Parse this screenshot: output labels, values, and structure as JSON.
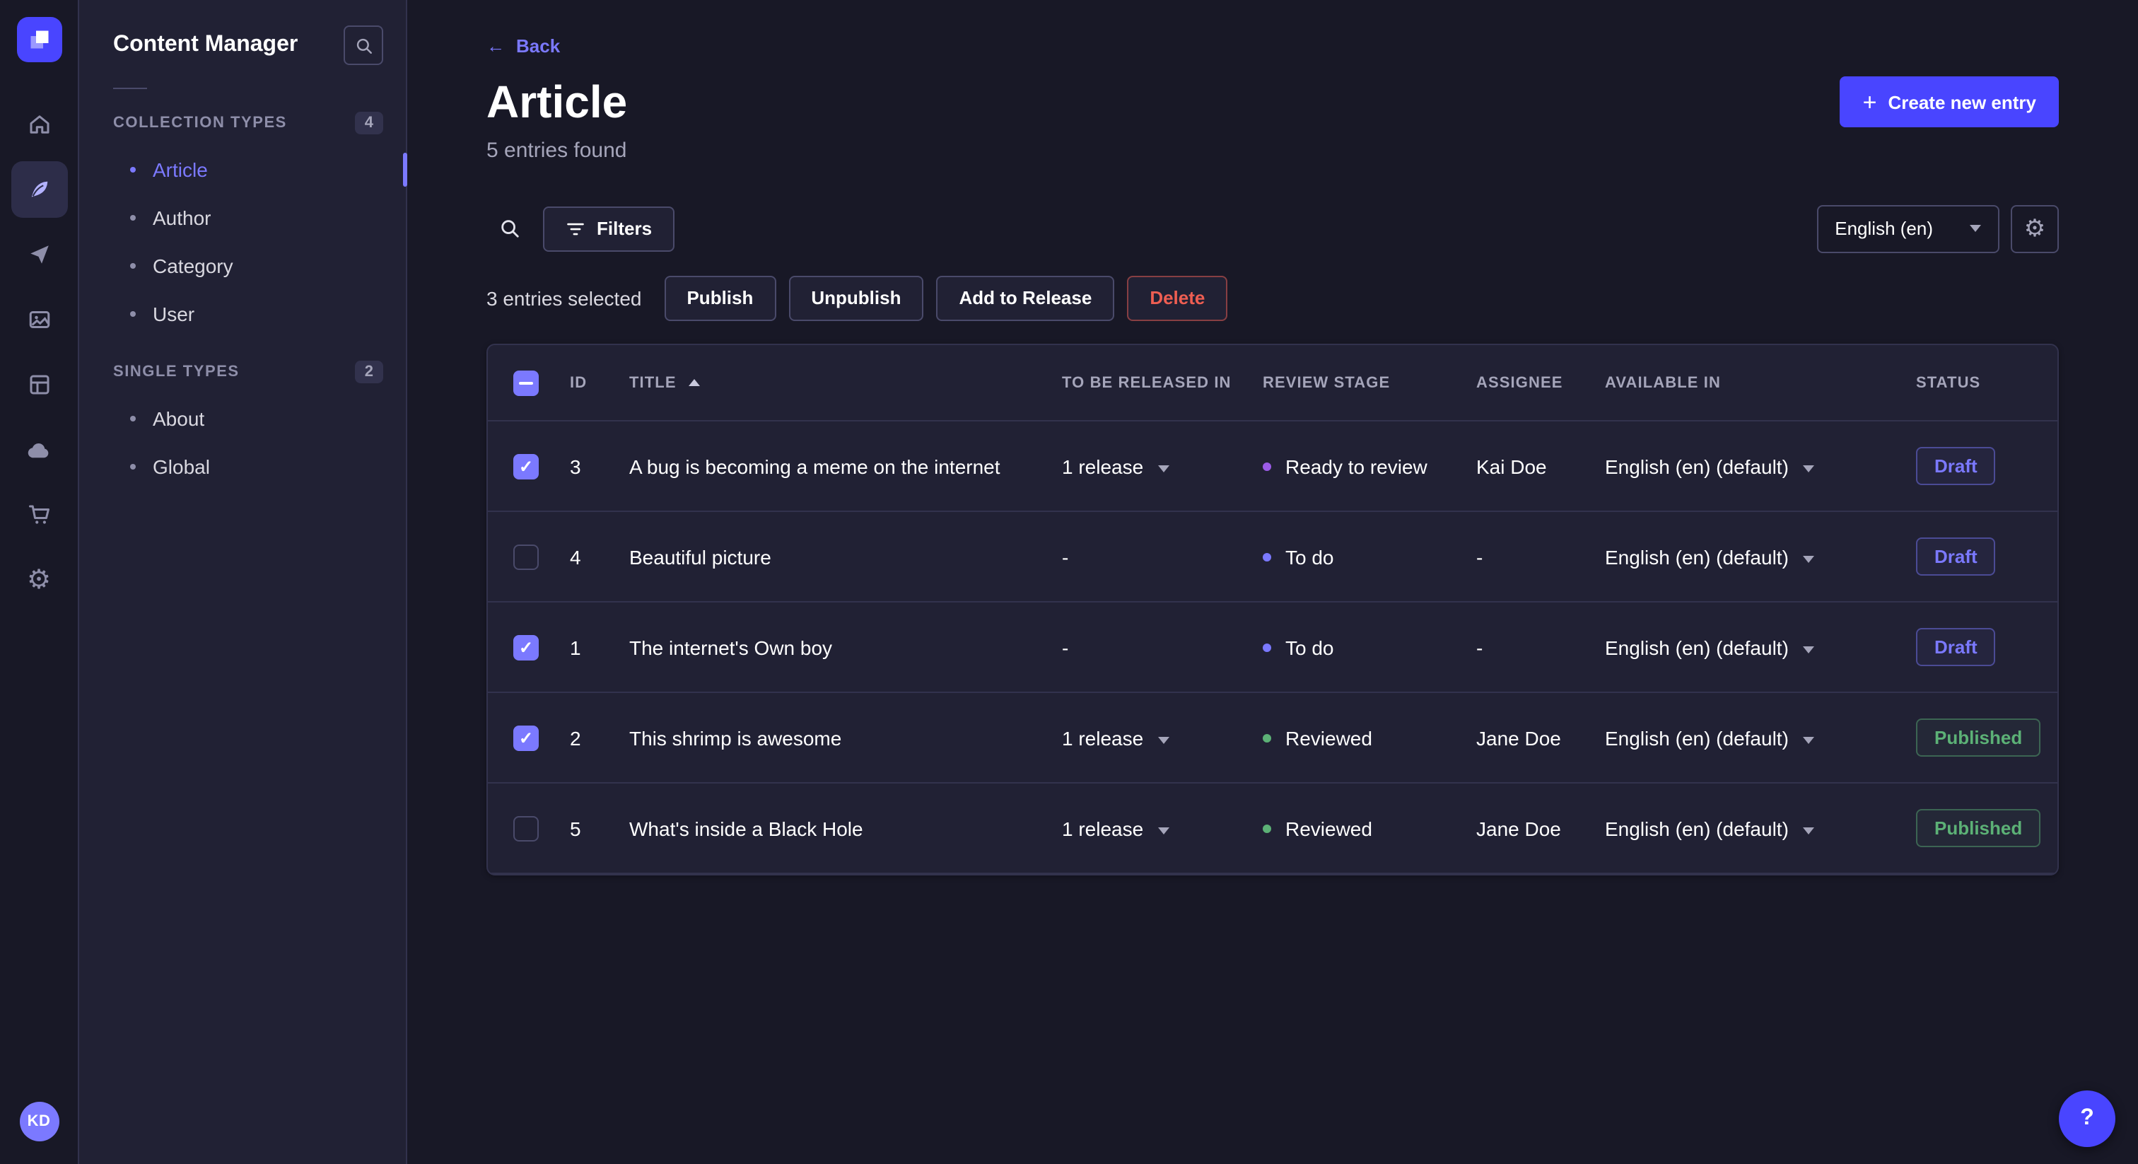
{
  "colors": {
    "primary": "#4945ff",
    "primary-light": "#7b79ff",
    "page-bg": "#181826",
    "surface": "#212134",
    "border": "#32324d",
    "border-strong": "#4a4a6a",
    "text": "#ffffff",
    "text-muted": "#a5a5ba",
    "text-subtle": "#8e8ea9",
    "danger": "#ee5e52",
    "success": "#5cb176",
    "stage-ready": "#9c5ce8",
    "stage-todo": "#7b79ff",
    "stage-reviewed": "#5cb176",
    "status-draft": "#7b79ff",
    "status-published": "#5cb176"
  },
  "icons": {
    "back-arrow": "←",
    "plus": "+",
    "settings-gear": "⚙",
    "help": "?"
  },
  "user": {
    "initials": "KD"
  },
  "sidebar": {
    "title": "Content Manager",
    "collection": {
      "label": "COLLECTION TYPES",
      "badge": "4",
      "items": [
        {
          "label": "Article",
          "active": true
        },
        {
          "label": "Author"
        },
        {
          "label": "Category"
        },
        {
          "label": "User"
        }
      ]
    },
    "single": {
      "label": "SINGLE TYPES",
      "badge": "2",
      "items": [
        {
          "label": "About"
        },
        {
          "label": "Global"
        }
      ]
    }
  },
  "header": {
    "back": "Back",
    "title": "Article",
    "subtitle": "5 entries found",
    "create_button": "Create new entry"
  },
  "toolbar": {
    "filters": "Filters",
    "locale": "English (en)"
  },
  "selection": {
    "summary": "3 entries selected",
    "publish": "Publish",
    "unpublish": "Unpublish",
    "add_to_release": "Add to Release",
    "delete": "Delete"
  },
  "table": {
    "columns": {
      "id": "ID",
      "title": "TITLE",
      "release": "TO BE RELEASED IN",
      "stage": "REVIEW STAGE",
      "assignee": "ASSIGNEE",
      "available": "AVAILABLE IN",
      "status": "STATUS"
    },
    "sort": {
      "column": "TITLE",
      "direction": "ascending"
    },
    "rows": [
      {
        "checked": true,
        "id": "3",
        "title": "A bug is becoming a meme on the internet",
        "release": "1 release",
        "release_caret": true,
        "release_interactable": "true",
        "stage": "Ready to review",
        "stage_key": "ready",
        "assignee": "Kai Doe",
        "locale": "English (en) (default)",
        "status": "Draft",
        "status_key": "draft"
      },
      {
        "checked": false,
        "id": "4",
        "title": "Beautiful picture",
        "release": "-",
        "release_caret": false,
        "release_interactable": "false",
        "stage": "To do",
        "stage_key": "todo",
        "assignee": "-",
        "locale": "English (en) (default)",
        "status": "Draft",
        "status_key": "draft"
      },
      {
        "checked": true,
        "id": "1",
        "title": "The internet's Own boy",
        "release": "-",
        "release_caret": false,
        "release_interactable": "false",
        "stage": "To do",
        "stage_key": "todo",
        "assignee": "-",
        "locale": "English (en) (default)",
        "status": "Draft",
        "status_key": "draft"
      },
      {
        "checked": true,
        "id": "2",
        "title": "This shrimp is awesome",
        "release": "1 release",
        "release_caret": true,
        "release_interactable": "true",
        "stage": "Reviewed",
        "stage_key": "reviewed",
        "assignee": "Jane Doe",
        "locale": "English (en) (default)",
        "status": "Published",
        "status_key": "published"
      },
      {
        "checked": false,
        "id": "5",
        "title": "What's inside a Black Hole",
        "release": "1 release",
        "release_caret": true,
        "release_interactable": "true",
        "stage": "Reviewed",
        "stage_key": "reviewed",
        "assignee": "Jane Doe",
        "locale": "English (en) (default)",
        "status": "Published",
        "status_key": "published"
      }
    ]
  }
}
